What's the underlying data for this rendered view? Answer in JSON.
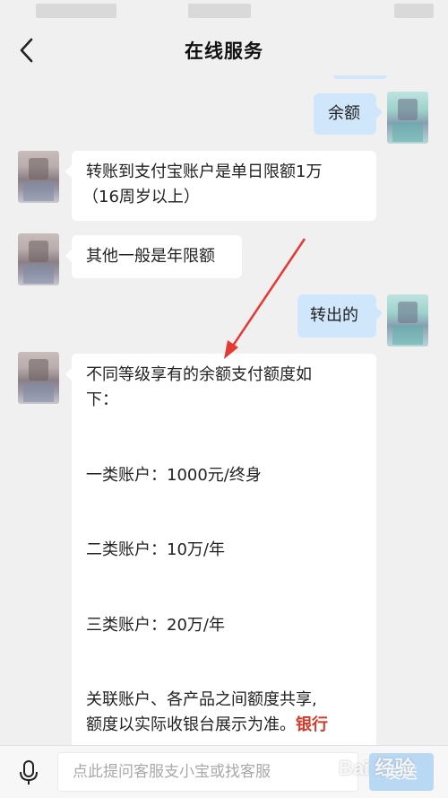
{
  "header": {
    "title": "在线服务"
  },
  "messages": {
    "m1": {
      "side": "right",
      "text": "余额"
    },
    "m2": {
      "side": "left",
      "lines": [
        "转账到支付宝账户是单日限额1万",
        "（16周岁以上）"
      ]
    },
    "m3": {
      "side": "left",
      "text": "其他一般是年限额"
    },
    "m4": {
      "side": "right",
      "text": "转出的"
    },
    "m5": {
      "side": "left",
      "lines": [
        "不同等级享有的余额支付额度如",
        "下：",
        "一类账户：1000元/终身",
        "二类账户：10万/年",
        "三类账户：20万/年",
        "关联账户、各产品之间额度共享,",
        "额度以实际收银台展示为准。"
      ],
      "link": "银行"
    }
  },
  "input": {
    "placeholder": "点此提问客服支小宝或找客服"
  },
  "send": {
    "label": "发送"
  },
  "watermark": {
    "text": "Bai 经验"
  },
  "colors": {
    "background": "#f0f0f0",
    "bubble_left": "#ffffff",
    "bubble_right": "#cfe6fb",
    "annotation_arrow": "#e53935",
    "link": "#d23a2a"
  },
  "icons": {
    "back": "chevron-left-icon",
    "mic": "microphone-icon"
  }
}
